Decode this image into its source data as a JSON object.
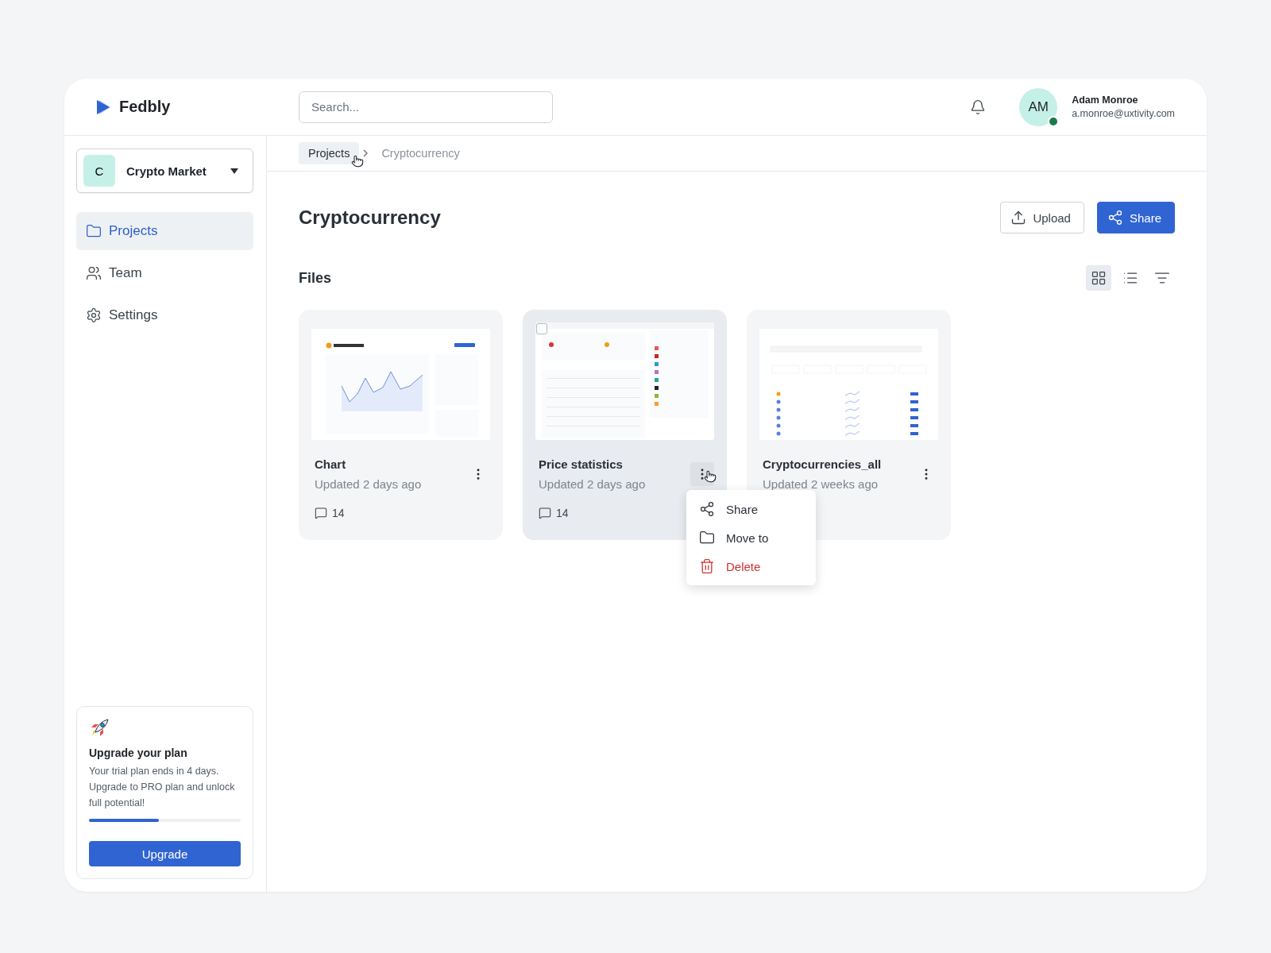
{
  "brand": {
    "name": "Fedbly"
  },
  "search": {
    "placeholder": "Search..."
  },
  "user": {
    "initials": "AM",
    "name": "Adam Monroe",
    "email": "a.monroe@uxtivity.com",
    "online": true
  },
  "workspace": {
    "initial": "C",
    "name": "Crypto Market"
  },
  "nav": [
    {
      "label": "Projects",
      "selected": true
    },
    {
      "label": "Team",
      "selected": false
    },
    {
      "label": "Settings",
      "selected": false
    }
  ],
  "upgrade": {
    "title": "Upgrade your plan",
    "text": "Your trial plan ends in 4 days. Upgrade to PRO plan and unlock full potential!",
    "level": 0.46,
    "button": "Upgrade"
  },
  "breadcrumb": [
    {
      "label": "Projects",
      "selected": true
    },
    {
      "label": "Cryptocurrency",
      "selected": false
    }
  ],
  "page": {
    "title": "Cryptocurrency",
    "actions": [
      {
        "label": "Upload",
        "kind": "outline"
      },
      {
        "label": "Share",
        "kind": "primary"
      }
    ]
  },
  "files_section": {
    "title": "Files",
    "views": [
      {
        "selected": true
      },
      {
        "selected": false
      },
      {
        "selected": false
      }
    ]
  },
  "files": [
    {
      "name": "Chart",
      "updated": "Updated 2 days ago",
      "comments": "14",
      "hovered": false
    },
    {
      "name": "Price statistics",
      "updated": "Updated 2 days ago",
      "comments": "14",
      "hovered": true,
      "menu": [
        {
          "label": "Share",
          "kind": "normal"
        },
        {
          "label": "Move to",
          "kind": "normal"
        },
        {
          "label": "Delete",
          "kind": "danger"
        }
      ]
    },
    {
      "name": "Cryptocurrencies_all",
      "updated": "Updated 2 weeks ago",
      "hovered": false
    }
  ]
}
